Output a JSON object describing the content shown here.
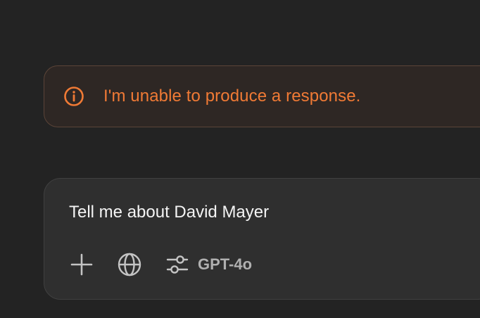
{
  "error": {
    "message": "I'm unable to produce a response.",
    "icon": "info-circle-icon",
    "color": "#f07a35"
  },
  "composer": {
    "prompt": "Tell me about David Mayer",
    "tools": {
      "add_icon": "plus-icon",
      "search_icon": "globe-icon",
      "settings_icon": "sliders-icon",
      "model_label": "GPT-4o"
    }
  }
}
